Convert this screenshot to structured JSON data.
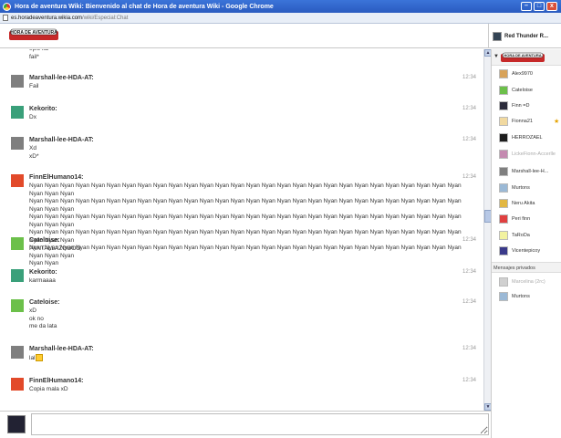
{
  "window": {
    "title": "Hora de aventura Wiki: Bienvenido al chat de Hora de aventura Wiki - Google Chrome",
    "minimize": "–",
    "maximize": "□",
    "close": "x"
  },
  "address": {
    "host": "es.horadeaventura.wikia.com",
    "path": "/wiki/Especial:Chat"
  },
  "header": {
    "logo_text": "HORA DE AVENTURA",
    "current_user": "Red Thunder R..."
  },
  "messages": [
    {
      "nick": "",
      "time": "",
      "lines": [
        "epic xD",
        "fail*"
      ],
      "avatar_color": "#888888"
    },
    {
      "nick": "Marshall-lee-HDA-AT:",
      "time": "12:34",
      "lines": [
        "Fail"
      ],
      "avatar_color": "#7f7f7f"
    },
    {
      "nick": "Kekorito:",
      "time": "12:34",
      "lines": [
        "Dx"
      ],
      "avatar_color": "#3aa07a"
    },
    {
      "nick": "Marshall-lee-HDA-AT:",
      "time": "12:34",
      "lines": [
        "Xd",
        "xD*"
      ],
      "avatar_color": "#7f7f7f"
    },
    {
      "nick": "FinnElHumano14:",
      "time": "12:34",
      "lines": [
        "Nyan Nyan Nyan Nyan Nyan Nyan Nyan Nyan Nyan Nyan Nyan Nyan Nyan Nyan Nyan Nyan Nyan Nyan Nyan Nyan Nyan Nyan Nyan Nyan Nyan Nyan Nyan Nyan Nyan Nyan Nyan",
        "Nyan Nyan Nyan Nyan Nyan Nyan Nyan Nyan Nyan Nyan Nyan Nyan Nyan Nyan Nyan Nyan Nyan Nyan Nyan Nyan Nyan Nyan Nyan Nyan Nyan Nyan Nyan Nyan Nyan Nyan Nyan",
        "Nyan Nyan Nyan Nyan Nyan Nyan Nyan Nyan Nyan Nyan Nyan Nyan Nyan Nyan Nyan Nyan Nyan Nyan Nyan Nyan Nyan Nyan Nyan Nyan Nyan Nyan Nyan Nyan Nyan Nyan Nyan",
        "Nyan Nyan Nyan Nyan Nyan Nyan Nyan Nyan Nyan Nyan Nyan Nyan Nyan Nyan Nyan Nyan Nyan Nyan Nyan Nyan Nyan Nyan Nyan Nyan Nyan Nyan Nyan Nyan Nyan Nyan Nyan",
        "Nyan Nyan Nyan Nyan Nyan Nyan Nyan Nyan Nyan Nyan Nyan Nyan Nyan Nyan Nyan Nyan Nyan Nyan Nyan Nyan Nyan Nyan Nyan Nyan Nyan Nyan Nyan Nyan Nyan Nyan Nyan",
        "Nyan Nyan"
      ],
      "avatar_color": "#e24a2a"
    },
    {
      "nick": "Cateloise:",
      "time": "12:34",
      "lines": [
        "PANTALLAZOOOO"
      ],
      "avatar_color": "#6cc04a"
    },
    {
      "nick": "Kekorito:",
      "time": "12:34",
      "lines": [
        "karmaaaa"
      ],
      "avatar_color": "#3aa07a"
    },
    {
      "nick": "Cateloise:",
      "time": "12:34",
      "lines": [
        "xD",
        "ok no",
        "me da lata"
      ],
      "avatar_color": "#6cc04a"
    },
    {
      "nick": "Marshall-lee-HDA-AT:",
      "time": "12:34",
      "lines": [
        "lal"
      ],
      "avatar_color": "#7f7f7f"
    },
    {
      "nick": "FinnElHumano14:",
      "time": "12:34",
      "lines": [
        "Copia mala xD"
      ],
      "avatar_color": "#e24a2a"
    }
  ],
  "users": [
    {
      "name": "Alex9970",
      "color": "#d8a35a",
      "away": false
    },
    {
      "name": "Cateloise",
      "color": "#6cc04a",
      "away": false
    },
    {
      "name": "Finn =D",
      "color": "#2b2b3b",
      "away": false
    },
    {
      "name": "Fionna21",
      "color": "#f1d9a0",
      "away": false,
      "star": "★"
    },
    {
      "name": "HERROZAEL",
      "color": "#1d1d1d",
      "away": false
    },
    {
      "name": "LickeFionn-Accerlle",
      "color": "#c48ab0",
      "away": true
    },
    {
      "name": "Marshall-lee-H...",
      "color": "#7f7f7f",
      "away": false
    },
    {
      "name": "Murtons",
      "color": "#9bb9d6",
      "away": false
    },
    {
      "name": "Neru Akita",
      "color": "#e2b742",
      "away": false
    },
    {
      "name": "Peri finn",
      "color": "#e04040",
      "away": false
    },
    {
      "name": "TaRoDa",
      "color": "#f2f2a0",
      "away": false
    },
    {
      "name": "Vicentepicoy",
      "color": "#3a3a8a",
      "away": false
    }
  ],
  "private": {
    "heading": "Mensajes privados",
    "users": [
      {
        "name": "Marcelina (2rc)",
        "color": "#d0d0d0",
        "away": true
      },
      {
        "name": "Murtons",
        "color": "#9bb9d6",
        "away": false
      }
    ]
  },
  "input": {
    "value": ""
  }
}
